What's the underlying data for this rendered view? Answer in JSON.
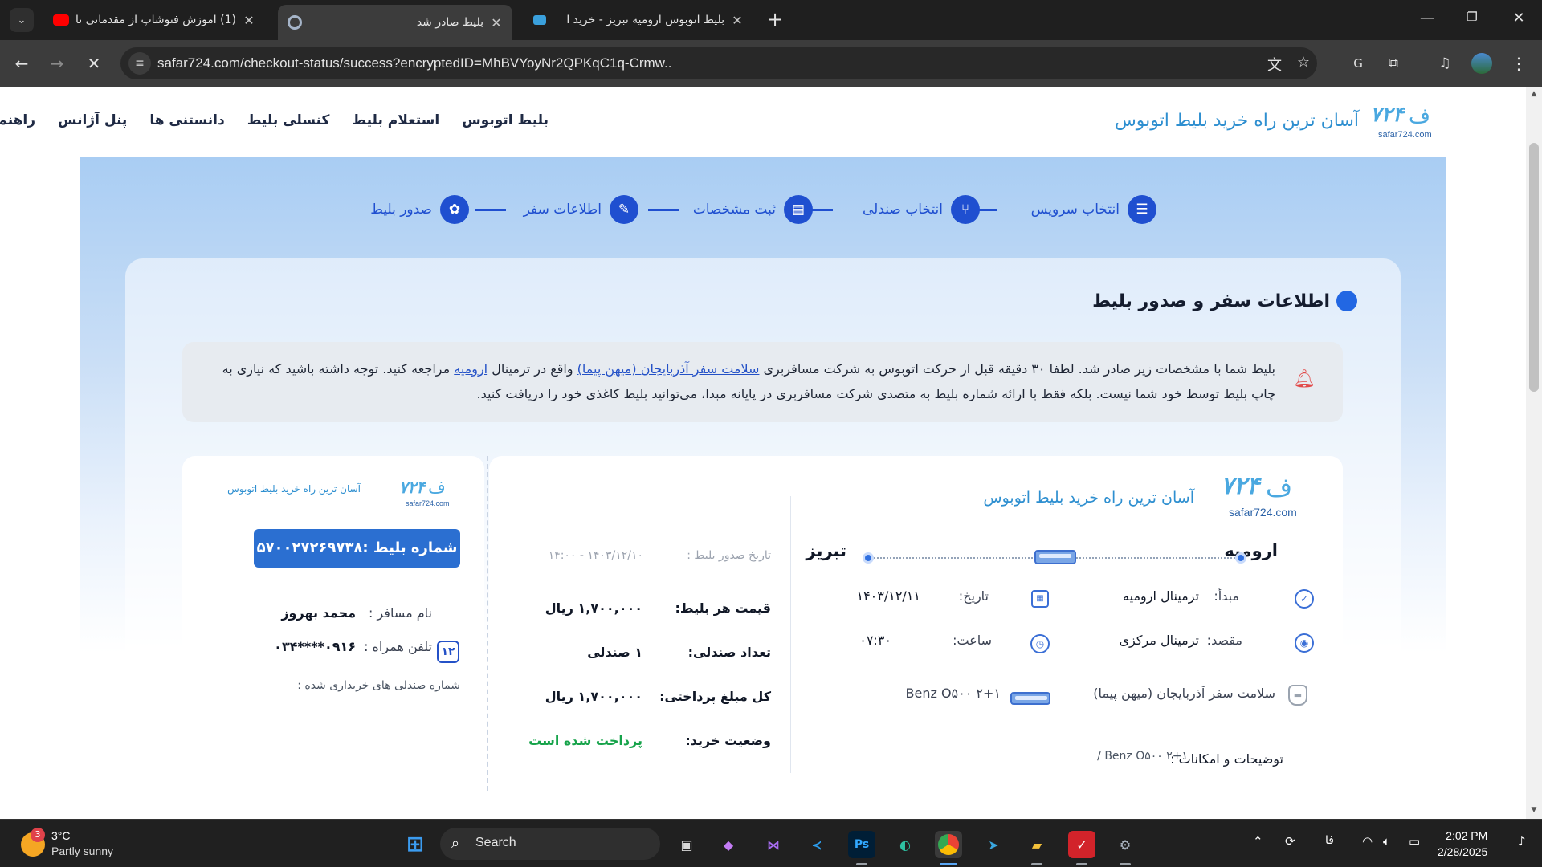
{
  "browser": {
    "tabs": [
      {
        "title": "(1) آموزش فتوشاپ از مقدماتی تا",
        "active": false
      },
      {
        "title": "بلیط صادر شد",
        "active": true
      },
      {
        "title": "بلیط اتوبوس ارومیه تبریز - خرید آ",
        "active": false
      }
    ],
    "url": "safar724.com/checkout-status/success?encryptedID=MhBVYoyNr2QPKqC1q-Crmw.."
  },
  "site": {
    "logo_num": "۷۲۴",
    "logo_domain": "safar724.com",
    "tagline": "آسان ترین راه خرید بلیط اتوبوس",
    "nav": [
      "بلیط اتوبوس",
      "استعلام بلیط",
      "کنسلی بلیط",
      "دانستنی ها",
      "پنل آژانس",
      "راهنما"
    ]
  },
  "steps": [
    "انتخاب سرویس",
    "انتخاب صندلی",
    "ثبت مشخصات",
    "اطلاعات سفر",
    "صدور بلیط"
  ],
  "section_title": "اطلاعات سفر و صدور بلیط",
  "notice": {
    "part1": "بلیط شما با مشخصات زیر صادر شد. لطفا ۳۰ دقیقه قبل از حرکت اتوبوس به شرکت مسافربری ",
    "company_link": "سلامت سفر آذربایجان (میهن پیما)",
    "part2": " واقع در ترمینال ",
    "terminal_link": "ارومیه",
    "part3": " مراجعه کنید. توجه داشته باشید که نیازی به چاپ بلیط توسط خود شما نیست. بلکه فقط با ارائه شماره بلیط به متصدی شرکت مسافربری در پایانه مبدا، می‌توانید بلیط کاغذی خود را دریافت کنید."
  },
  "ticket": {
    "tagline": "آسان ترین راه خرید بلیط اتوبوس",
    "origin_city": "ارومیه",
    "dest_city": "تبریز",
    "origin_label": "مبدأ:",
    "origin_value": "ترمینال ارومیه",
    "dest_label": "مقصد:",
    "dest_value": "ترمینال مرکزی",
    "date_label": "تاریخ:",
    "date_value": "۱۴۰۳/۱۲/۱۱",
    "time_label": "ساعت:",
    "time_value": "۰۷:۳۰",
    "company": "سلامت سفر آذربایجان (میهن پیما)",
    "bus_model": "Benz O۵۰۰ ۲+۱",
    "notes_label": "توضیحات و امکانات :",
    "notes_value": "Benz O۵۰۰ ۲+۱ /",
    "issue_label": "تاریخ صدور بلیط :",
    "issue_value": "۱۴۰۳/۱۲/۱۰ - ۱۴:۰۰",
    "price_label": "قیمت هر بلیط:",
    "price_value": "۱,۷۰۰,۰۰۰ ریال",
    "seats_label": "تعداد صندلی:",
    "seats_value": "۱ صندلی",
    "total_label": "کل مبلغ پرداختی:",
    "total_value": "۱,۷۰۰,۰۰۰ ریال",
    "status_label": "وضعیت خرید:",
    "status_value": "پرداخت شده است"
  },
  "stub": {
    "tagline": "آسان ترین راه خرید بلیط اتوبوس",
    "ticket_number": "شماره بلیط :۵۷۰۰۲۷۲۶۹۷۳۸",
    "passenger_label": "نام مسافر :",
    "passenger_value": "محمد بهروز",
    "phone_label": "تلفن همراه :",
    "phone_value": "۰۹۱۶****۰۳۴",
    "seats_bought_label": "شماره صندلی های خریداری شده :",
    "seat_number": "۱۲"
  },
  "taskbar": {
    "weather_temp": "3°C",
    "weather_desc": "Partly sunny",
    "weather_badge": "3",
    "search_label": "Search",
    "lang": "فا",
    "time": "2:02 PM",
    "date": "2/28/2025"
  },
  "colors": {
    "accent": "#1f4fd0",
    "brand": "#3aa0dc",
    "paid": "#16a34a"
  }
}
